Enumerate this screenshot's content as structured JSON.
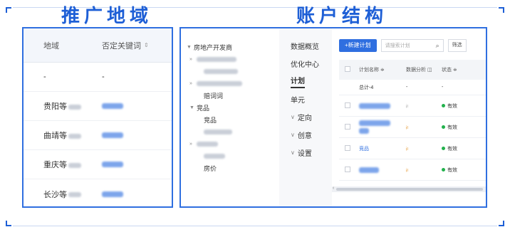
{
  "headings": {
    "left": "推广地域",
    "right": "账户结构"
  },
  "left_table": {
    "col_region": "地域",
    "col_negative": "否定关键词",
    "sort_icon": "sort-icon",
    "rows": [
      {
        "region": "-",
        "negative": "-"
      },
      {
        "region": "贵阳等",
        "negative": ""
      },
      {
        "region": "曲靖等",
        "negative": ""
      },
      {
        "region": "重庆等",
        "negative": ""
      },
      {
        "region": "长沙等",
        "negative": ""
      }
    ]
  },
  "tree": {
    "items": [
      {
        "label": "房地产开发商",
        "arrow": "▼"
      },
      {
        "label": "",
        "arrow": "»"
      },
      {
        "label": "",
        "arrow": ""
      },
      {
        "label": "",
        "arrow": "»"
      },
      {
        "label": "赔词词",
        "arrow": ""
      },
      {
        "label": "竞品",
        "arrow": "▼"
      },
      {
        "label": "竞品",
        "arrow": ""
      },
      {
        "label": "",
        "arrow": ""
      },
      {
        "label": "",
        "arrow": "»"
      },
      {
        "label": "",
        "arrow": ""
      },
      {
        "label": "房价",
        "arrow": ""
      }
    ]
  },
  "nav": {
    "items": [
      {
        "label": "数据概览",
        "chev": ""
      },
      {
        "label": "优化中心",
        "chev": ""
      },
      {
        "label": "计划",
        "chev": ""
      },
      {
        "label": "单元",
        "chev": ""
      },
      {
        "label": "定向",
        "chev": "∨"
      },
      {
        "label": "创意",
        "chev": "∨"
      },
      {
        "label": "设置",
        "chev": "∨"
      }
    ]
  },
  "toolbar": {
    "new_label": "+新建计划",
    "search_placeholder": "请搜索计划",
    "filter_label": "筛选"
  },
  "plan_table": {
    "col_name": "计划名称 ≑",
    "col_analysis": "数据分析",
    "col_status": "状态 ≑",
    "total_label": "总计-4",
    "total_dash1": "-",
    "total_dash2": "-",
    "rows": [
      {
        "name": "",
        "status": "有效",
        "icon_gray": true
      },
      {
        "name": "",
        "status": "有效",
        "icon_gray": false
      },
      {
        "name": "竞品",
        "status": "有效",
        "icon_gray": false
      },
      {
        "name": "",
        "status": "有效",
        "icon_gray": false
      }
    ]
  },
  "colors": {
    "accent": "#1e5fd6",
    "status_ok": "#22b14c"
  }
}
